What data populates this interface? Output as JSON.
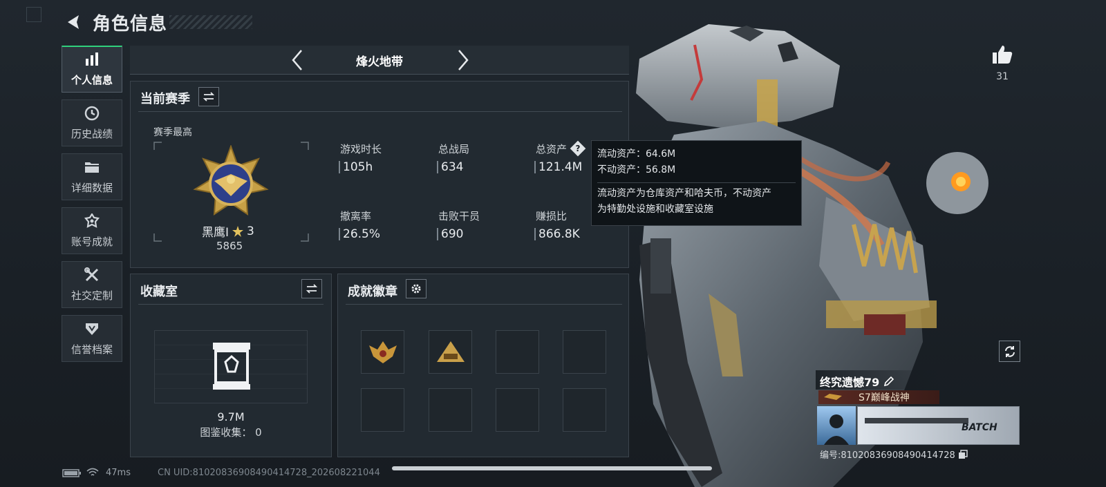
{
  "header": {
    "title": "角色信息"
  },
  "sidebar": {
    "items": [
      {
        "label": "个人信息",
        "icon": "bar-chart-icon",
        "active": true
      },
      {
        "label": "历史战绩",
        "icon": "history-icon",
        "active": false
      },
      {
        "label": "详细数据",
        "icon": "folder-icon",
        "active": false
      },
      {
        "label": "账号成就",
        "icon": "achievement-icon",
        "active": false
      },
      {
        "label": "社交定制",
        "icon": "tools-icon",
        "active": false
      },
      {
        "label": "信誉档案",
        "icon": "credit-icon",
        "active": false
      }
    ]
  },
  "map": {
    "name": "烽火地带"
  },
  "season": {
    "title": "当前赛季",
    "best_label": "赛季最高",
    "rank_name": "黑鹰Ⅰ",
    "rank_stars": "3",
    "rank_score": "5865",
    "stats": [
      {
        "label": "游戏时长",
        "value": "105h"
      },
      {
        "label": "总战局",
        "value": "634"
      },
      {
        "label": "总资产",
        "value": "121.4M"
      },
      {
        "label": "撤离率",
        "value": "26.5%"
      },
      {
        "label": "击败干员",
        "value": "690"
      },
      {
        "label": "赚损比",
        "value": "866.8K"
      }
    ]
  },
  "tooltip": {
    "liquid": "流动资产：64.6M",
    "fixed": "不动资产：56.8M",
    "desc_line1": "流动资产为仓库资产和哈夫币，不动资产",
    "desc_line2": "为特勤处设施和收藏室设施"
  },
  "collection": {
    "title": "收藏室",
    "value": "9.7M",
    "catalog": "图鉴收集： 0"
  },
  "badges": {
    "title": "成就徽章"
  },
  "likes": {
    "count": "31"
  },
  "player": {
    "name": "终究遗憾79",
    "title_badge": "S7巅峰战神",
    "id": "编号:810208369084904147​28",
    "id_clean": "编号:81020836908490414728"
  },
  "status": {
    "ping": "47ms",
    "uid": "CN UID:81020836908490414728_202608221044"
  },
  "colors": {
    "accent": "#2fd27c",
    "panel": "#222a31",
    "tooltip_bg": "#0f1418"
  }
}
